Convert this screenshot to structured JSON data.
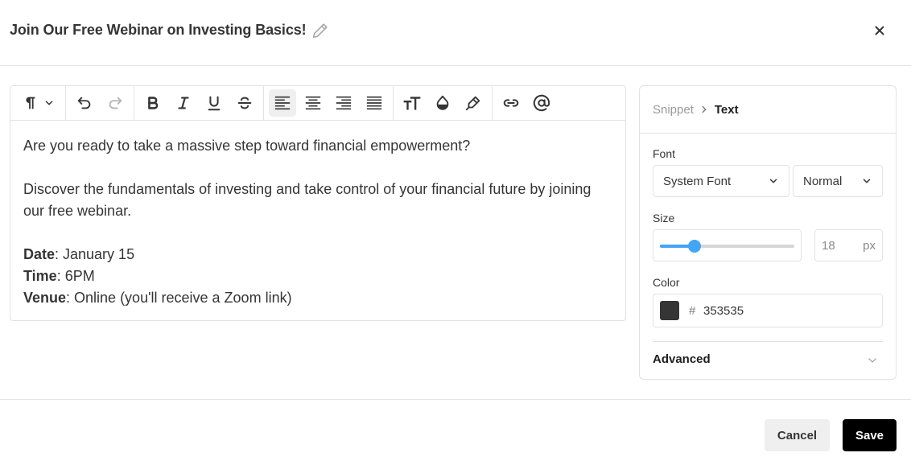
{
  "header": {
    "title": "Join Our Free Webinar on Investing Basics!",
    "edit_icon": "pencil-icon",
    "close_icon": "close-icon"
  },
  "toolbar": {
    "groups": [
      [
        "paragraph-format-icon"
      ],
      [
        "undo-icon",
        "redo-icon"
      ],
      [
        "bold-icon",
        "italic-icon",
        "underline-icon",
        "strikethrough-icon"
      ],
      [
        "align-left-icon",
        "align-center-icon",
        "align-right-icon",
        "align-justify-icon"
      ],
      [
        "font-size-icon",
        "text-color-icon",
        "highlight-icon"
      ],
      [
        "link-icon",
        "mention-icon"
      ]
    ],
    "active": "align-left-icon"
  },
  "content": {
    "p1": "Are you ready to take a massive step toward financial empowerment?",
    "p2": "Discover the fundamentals of investing and take control of your financial future by joining our free webinar.",
    "details": [
      {
        "label": "Date",
        "value": ": January 15"
      },
      {
        "label": "Time",
        "value": ": 6PM"
      },
      {
        "label": "Venue",
        "value": ": Online (you'll receive a Zoom link)"
      }
    ]
  },
  "panel": {
    "breadcrumb": [
      "Snippet",
      "Text"
    ],
    "font_label": "Font",
    "font_family": "System Font",
    "font_weight": "Normal",
    "size_label": "Size",
    "size_value": "18",
    "size_unit": "px",
    "size_slider_fraction": 0.26,
    "color_label": "Color",
    "color_hash": "#",
    "color_hex": "353535",
    "color_swatch": "#353535",
    "advanced_label": "Advanced"
  },
  "footer": {
    "cancel_label": "Cancel",
    "save_label": "Save"
  },
  "colors": {
    "accent": "#42a5f5",
    "primary_button": "#000000",
    "text": "#353535"
  }
}
